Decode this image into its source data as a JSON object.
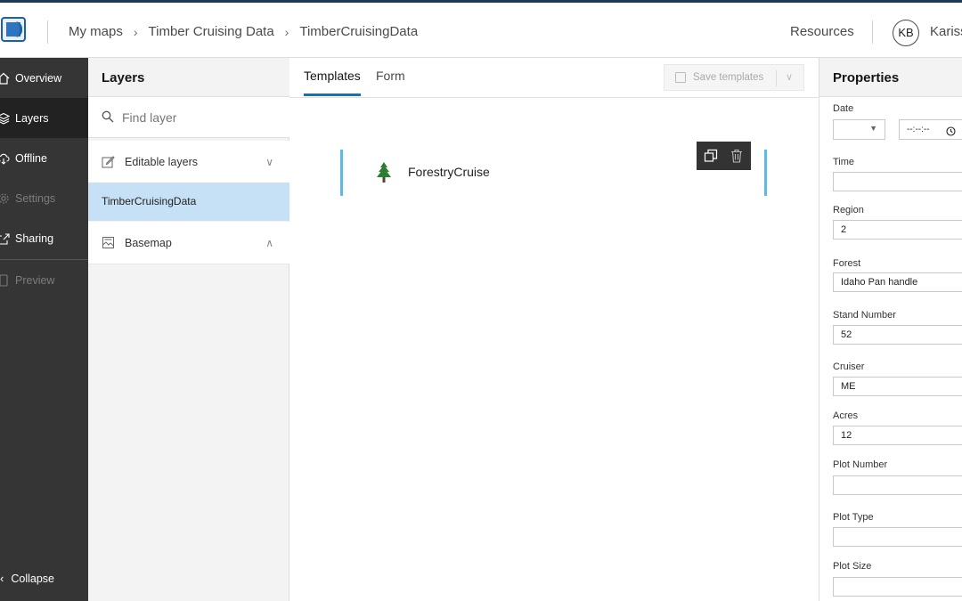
{
  "topbar": {
    "breadcrumb": [
      "My maps",
      "Timber Cruising Data",
      "TimberCruisingData"
    ],
    "resources_label": "Resources",
    "avatar_initials": "KB",
    "user_name": "Kariss"
  },
  "nav": {
    "items": [
      {
        "label": "Overview",
        "icon": "home-icon",
        "state": "normal"
      },
      {
        "label": "Layers",
        "icon": "layers-icon",
        "state": "active"
      },
      {
        "label": "Offline",
        "icon": "cloud-download-icon",
        "state": "normal"
      },
      {
        "label": "Settings",
        "icon": "gear-icon",
        "state": "disabled"
      },
      {
        "label": "Sharing",
        "icon": "share-icon",
        "state": "normal"
      },
      {
        "label": "Preview",
        "icon": "phone-icon",
        "state": "disabled"
      }
    ],
    "collapse_label": "Collapse"
  },
  "layers": {
    "title": "Layers",
    "search_placeholder": "Find layer",
    "editable_group_label": "Editable layers",
    "selected_layer": "TimberCruisingData",
    "basemap_label": "Basemap"
  },
  "center": {
    "tabs": [
      "Templates",
      "Form"
    ],
    "active_tab": "Templates",
    "save_templates_label": "Save templates",
    "template_name": "ForestryCruise"
  },
  "properties": {
    "title": "Properties",
    "date_label": "Date",
    "time_placeholder": "--:--:--",
    "fields": [
      {
        "label": "Time",
        "value": ""
      },
      {
        "label": "Region",
        "value": "2"
      },
      {
        "label": "Forest",
        "value": "Idaho Pan handle"
      },
      {
        "label": "Stand Number",
        "value": "52"
      },
      {
        "label": "Cruiser",
        "value": "ME"
      },
      {
        "label": "Acres",
        "value": "12"
      },
      {
        "label": "Plot Number",
        "value": ""
      },
      {
        "label": "Plot Type",
        "value": ""
      },
      {
        "label": "Plot Size",
        "value": ""
      }
    ]
  },
  "colors": {
    "accent": "#0079c1",
    "selected_row": "#c6e1f5",
    "nav_bg": "#353535"
  }
}
